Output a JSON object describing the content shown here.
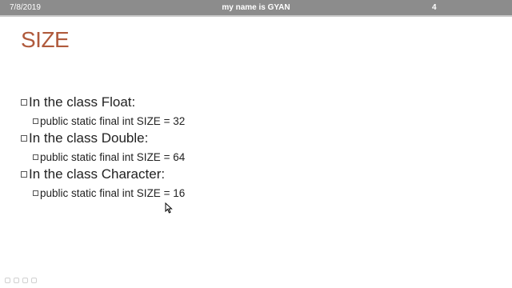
{
  "header": {
    "date": "7/8/2019",
    "center_text": "my name is GYAN",
    "page_number": "4"
  },
  "slide": {
    "title": "SIZE",
    "bullets": [
      {
        "text": "In the class Float:",
        "sub": "public static final int SIZE = 32"
      },
      {
        "text": "In the class Double:",
        "sub": "public static final int SIZE = 64"
      },
      {
        "text": "In the class Character:",
        "sub": "public static final int SIZE = 16"
      }
    ]
  },
  "icons": {
    "bullet": "square-bullet-icon",
    "cursor": "mouse-pointer-icon",
    "toolbar": [
      "arrow-icon",
      "pen-icon",
      "slides-icon",
      "zoom-icon"
    ]
  },
  "colors": {
    "header_bg": "#8c8c8c",
    "title": "#b05a3c",
    "text": "#222222"
  }
}
